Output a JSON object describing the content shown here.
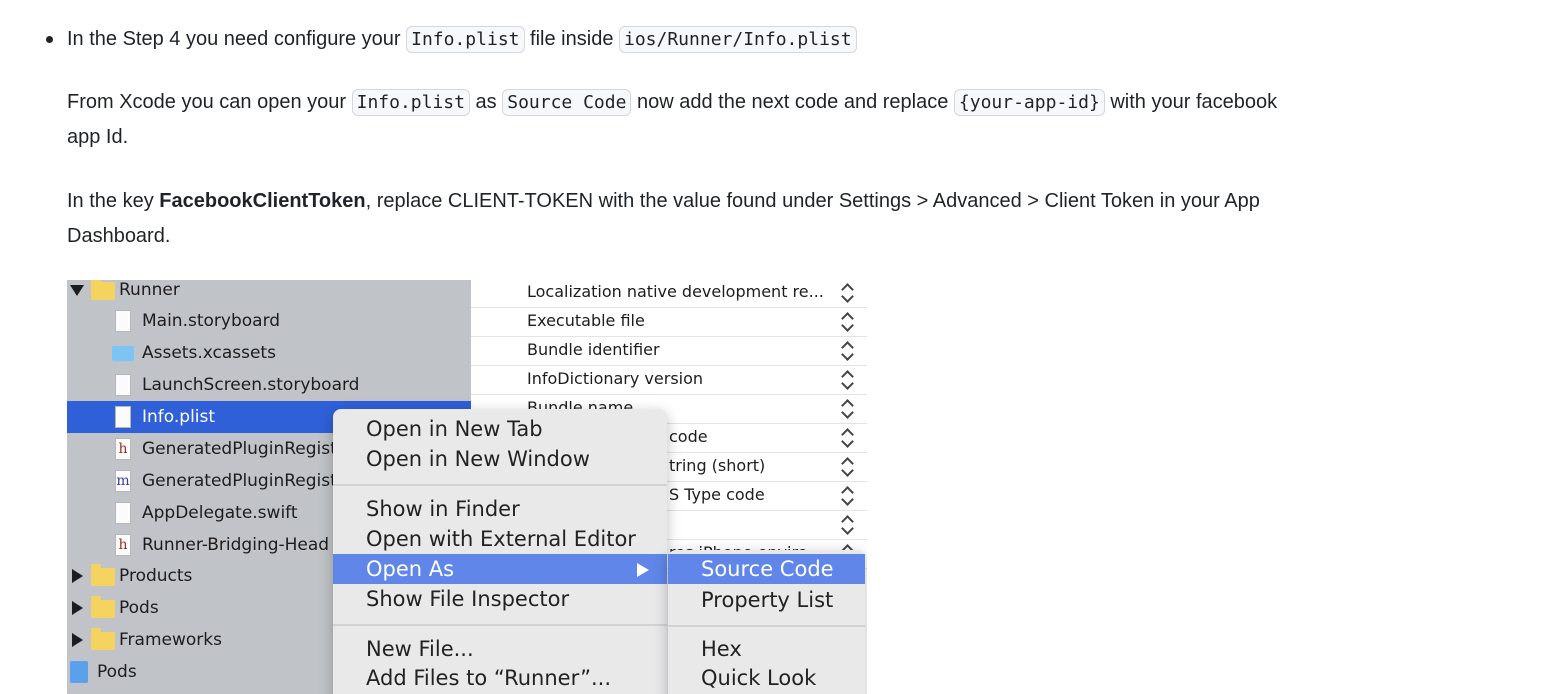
{
  "bullet": {
    "pre": "In the Step 4 you need configure your ",
    "code1": "Info.plist",
    "mid": " file inside ",
    "code2": "ios/Runner/Info.plist"
  },
  "para1": {
    "t1": "From Xcode you can open your ",
    "c1": "Info.plist",
    "t2": " as ",
    "c2": "Source Code",
    "t3": " now add the next code and replace ",
    "c3": "{your-app-id}",
    "t4": " with your facebook app Id."
  },
  "para2": {
    "t1": "In the key ",
    "bold": "FacebookClientToken",
    "t2": ", replace CLIENT-TOKEN with the value found under Settings > Advanced > Client Token in your App Dashboard."
  },
  "navigator": {
    "runner": "Runner",
    "main_storyboard": "Main.storyboard",
    "assets": "Assets.xcassets",
    "launch": "LaunchScreen.storyboard",
    "info_plist": "Info.plist",
    "gen_h": "GeneratedPluginRegist",
    "gen_m": "GeneratedPluginRegist",
    "appdelegate": "AppDelegate.swift",
    "bridging": "Runner-Bridging-Head",
    "products": "Products",
    "pods": "Pods",
    "frameworks": "Frameworks",
    "pods_project": "Pods",
    "h_glyph": "h",
    "m_glyph": "m"
  },
  "plist_rows": [
    "Localization native development re...",
    "Executable file",
    "Bundle identifier",
    "InfoDictionary version",
    "Bundle name",
    "code",
    "tring (short)",
    "S Type code",
    "",
    "res iPhone enviro"
  ],
  "context_menu": {
    "open_new_tab": "Open in New Tab",
    "open_new_window": "Open in New Window",
    "show_in_finder": "Show in Finder",
    "open_external": "Open with External Editor",
    "open_as": "Open As",
    "show_inspector": "Show File Inspector",
    "new_file": "New File...",
    "add_files": "Add Files to “Runner”..."
  },
  "submenu": {
    "source_code": "Source Code",
    "property_list": "Property List",
    "hex": "Hex",
    "quick_look": "Quick Look"
  },
  "colors": {
    "selection": "#2f60d8",
    "menu_highlight": "#5f86e8",
    "navigator_bg": "#c0c3c7",
    "folder": "#f4d35e"
  }
}
